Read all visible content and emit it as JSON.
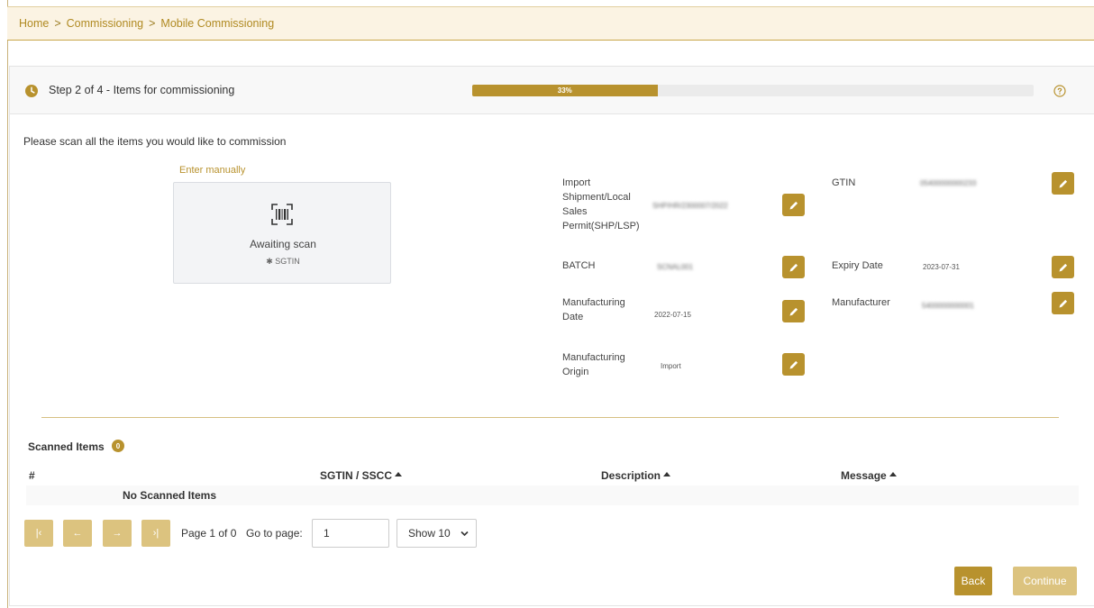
{
  "breadcrumb": {
    "items": [
      "Home",
      "Commissioning",
      "Mobile Commissioning"
    ],
    "separator": ">"
  },
  "step": {
    "title": "Step 2 of 4 - Items for commissioning",
    "progress_label": "33%",
    "progress_percent": 33
  },
  "instruction": "Please scan all the items you would like to commission",
  "scanner": {
    "enter_manually": "Enter manually",
    "status": "Awaiting scan",
    "type_label": "✱ SGTIN"
  },
  "fields": {
    "import_permit": {
      "label": "Import Shipment/Local Sales Permit(SHP/LSP)",
      "value": "SHP/HR/2300007/2022"
    },
    "gtin": {
      "label": "GTIN",
      "value": "05400000000233"
    },
    "batch": {
      "label": "BATCH",
      "value": "SCNAL001"
    },
    "expiry_date": {
      "label": "Expiry Date",
      "value": "2023-07-31"
    },
    "manufacturing_date": {
      "label": "Manufacturing Date",
      "value": "2022-07-15"
    },
    "manufacturer": {
      "label": "Manufacturer",
      "value": "5400000000001"
    },
    "manufacturing_origin": {
      "label": "Manufacturing Origin",
      "value": "Import"
    }
  },
  "scanned": {
    "title": "Scanned Items",
    "count": "0",
    "columns": [
      "#",
      "SGTIN / SSCC",
      "Description",
      "Message"
    ],
    "empty_text": "No Scanned Items"
  },
  "pagination": {
    "first": "|‹",
    "prev": "←",
    "next": "→",
    "last": "›|",
    "page_info": "Page 1 of 0",
    "goto_label": "Go to page:",
    "goto_value": "1",
    "show_value": "Show 10"
  },
  "actions": {
    "back": "Back",
    "continue": "Continue"
  },
  "colors": {
    "accent": "#b8922e",
    "accent_disabled": "#dcc37f",
    "breadcrumb_bg": "#fbf3e3"
  }
}
